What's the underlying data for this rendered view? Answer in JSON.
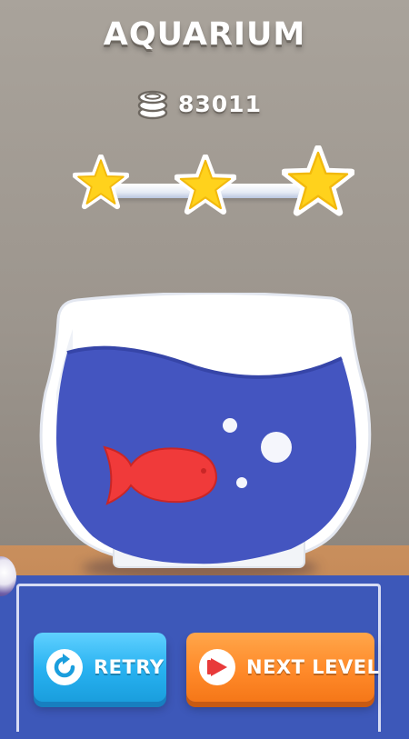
{
  "header": {
    "title": "AQUARIUM"
  },
  "wallet": {
    "coins": "83011",
    "icon": "coin-stack-icon"
  },
  "rating": {
    "stars_earned": 3,
    "stars_total": 3
  },
  "buttons": {
    "retry": {
      "label": "RETRY",
      "icon": "retry-icon"
    },
    "next": {
      "label": "NEXT LEVEL",
      "icon": "play-icon"
    }
  },
  "colors": {
    "star": "#ffd21c",
    "retry": "#27b1f0",
    "next": "#ff8a2a",
    "water": "#4455c0",
    "fish": "#f03a3a"
  }
}
